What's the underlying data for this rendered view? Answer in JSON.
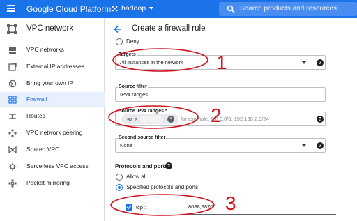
{
  "topbar": {
    "brand": "Google Cloud Platform",
    "project_name": "hadoop",
    "search_placeholder": "Search products and resources"
  },
  "sidebar": {
    "title": "VPC network",
    "items": [
      {
        "label": "VPC networks",
        "icon": "network-grid-icon",
        "active": false
      },
      {
        "label": "External IP addresses",
        "icon": "external-ip-icon",
        "active": false
      },
      {
        "label": "Bring your own IP",
        "icon": "byoip-globe-icon",
        "active": false
      },
      {
        "label": "Firewall",
        "icon": "firewall-icon",
        "active": true
      },
      {
        "label": "Routes",
        "icon": "routes-icon",
        "active": false
      },
      {
        "label": "VPC network peering",
        "icon": "peering-icon",
        "active": false
      },
      {
        "label": "Shared VPC",
        "icon": "shared-vpc-icon",
        "active": false
      },
      {
        "label": "Serverless VPC access",
        "icon": "serverless-icon",
        "active": false
      },
      {
        "label": "Packet mirroring",
        "icon": "packet-mirroring-icon",
        "active": false
      }
    ]
  },
  "main": {
    "title": "Create a firewall rule",
    "deny_label": "Deny",
    "targets": {
      "label": "Targets",
      "value": "All instances in the network"
    },
    "source_filter": {
      "label": "Source filter",
      "value": "IPv4 ranges"
    },
    "source_ranges": {
      "label": "Source IPv4 ranges *",
      "chip_text": "92.2",
      "placeholder": "for example, 0.0.0.0/0, 192.168.2.0/24"
    },
    "second_source_filter": {
      "label": "Second source filter",
      "value": "None"
    },
    "protocols": {
      "label": "Protocols and ports",
      "allow_all": "Allow all",
      "specified": "Specified protocols and ports",
      "tcp_label": "tcp :",
      "tcp_ports": "8088,9870"
    }
  },
  "annotations": {
    "n1": "1",
    "n2": "2",
    "n3": "3"
  },
  "colors": {
    "accent": "#1a73e8",
    "annotation": "#d0111b"
  }
}
